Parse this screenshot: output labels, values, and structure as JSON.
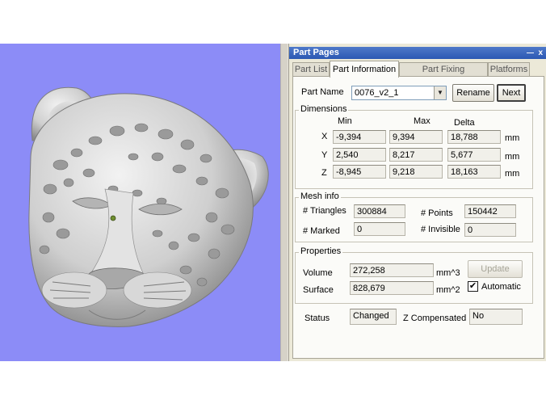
{
  "panel": {
    "title": "Part Pages",
    "pin_icon": "―",
    "close_icon": "x",
    "tabs": [
      "Part List",
      "Part Information",
      "Part Fixing Information",
      "Platforms"
    ],
    "active_tab": "Part Information"
  },
  "part": {
    "name_label": "Part Name",
    "name_value": "0076_v2_1",
    "rename_label": "Rename",
    "next_label": "Next"
  },
  "dimensions": {
    "title": "Dimensions",
    "headers": [
      "Min",
      "Max",
      "Delta"
    ],
    "rows": [
      {
        "axis": "X",
        "min": "-9,394",
        "max": "9,394",
        "delta": "18,788",
        "unit": "mm"
      },
      {
        "axis": "Y",
        "min": "2,540",
        "max": "8,217",
        "delta": "5,677",
        "unit": "mm"
      },
      {
        "axis": "Z",
        "min": "-8,945",
        "max": "9,218",
        "delta": "18,163",
        "unit": "mm"
      }
    ]
  },
  "mesh": {
    "title": "Mesh info",
    "triangles_label": "# Triangles",
    "triangles_value": "300884",
    "points_label": "# Points",
    "points_value": "150442",
    "marked_label": "# Marked",
    "marked_value": "0",
    "invisible_label": "# Invisible",
    "invisible_value": "0"
  },
  "properties": {
    "title": "Properties",
    "volume_label": "Volume",
    "volume_value": "272,258",
    "volume_unit": "mm^3",
    "update_label": "Update",
    "surface_label": "Surface",
    "surface_value": "828,679",
    "surface_unit": "mm^2",
    "automatic_label": "Automatic",
    "automatic_checked": true
  },
  "status": {
    "status_label": "Status",
    "status_value": "Changed",
    "zcomp_label": "Z Compensated",
    "zcomp_value": "No"
  },
  "colors": {
    "viewport_bg": "#8c8cf7",
    "panel_bg": "#ece9d8",
    "title_bar": "#2b58b3"
  }
}
